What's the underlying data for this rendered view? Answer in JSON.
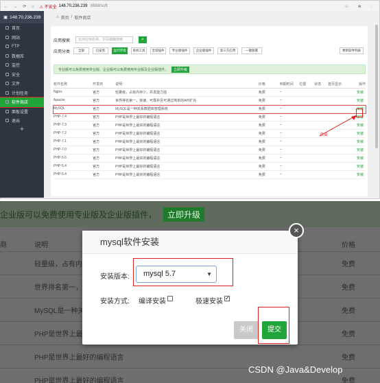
{
  "browser": {
    "nav": "← → ⟳ ⌂",
    "warn": "⚠ 不安全",
    "host": "148.70.236.239",
    "path": ":8888/soft",
    "icons": "☆ ⊕ :"
  },
  "sidebar": {
    "ip": "148.70.236.239",
    "items": [
      {
        "label": "首页"
      },
      {
        "label": "网站"
      },
      {
        "label": "FTP"
      },
      {
        "label": "数据库"
      },
      {
        "label": "监控"
      },
      {
        "label": "安全"
      },
      {
        "label": "文件"
      },
      {
        "label": "计划任务"
      },
      {
        "label": "软件商店"
      },
      {
        "label": "面板设置"
      },
      {
        "label": "退出"
      }
    ],
    "add": "+"
  },
  "crumb": {
    "home": "首页",
    "sep": "/",
    "current": "软件商店"
  },
  "search": {
    "label": "应用搜索",
    "placeholder": "支持应用名称、字段模糊搜索"
  },
  "categories": {
    "label": "应用分类",
    "items": [
      "全部",
      "已安装",
      "运行环境",
      "系统工具",
      "宝塔插件",
      "专业版插件",
      "企业版插件",
      "第三方应用",
      "一键部署"
    ],
    "filter": "更新软件列表"
  },
  "banner": {
    "text": "专业版可以免费使用专业版、企业版可以免费使用专业版及企业版插件，",
    "button": "立即升级"
  },
  "table": {
    "headers": [
      "软件名称",
      "开发商",
      "说明",
      "价格",
      "到期时间",
      "位置",
      "状态",
      "首页显示",
      "操作"
    ],
    "rows": [
      {
        "name": "Nginx",
        "dev": "官方",
        "desc": "轻量级，占有内存少，并发能力强",
        "price": "免费",
        "exp": "--",
        "op": "安装"
      },
      {
        "name": "Apache",
        "dev": "官方",
        "desc": "世界排名第一，快速、可靠并且可通过简单的API扩充",
        "price": "免费",
        "exp": "--",
        "op": "安装"
      },
      {
        "name": "MySQL",
        "dev": "官方",
        "desc": "MySQL是一种关系数据库管理系统",
        "price": "免费",
        "exp": "--",
        "op": "安装"
      },
      {
        "name": "PHP-7.4",
        "dev": "官方",
        "desc": "PHP是世界上最好的编程语言",
        "price": "免费",
        "exp": "--",
        "op": "安装"
      },
      {
        "name": "PHP-7.3",
        "dev": "官方",
        "desc": "PHP是世界上最好的编程语言",
        "price": "免费",
        "exp": "--",
        "op": "安装"
      },
      {
        "name": "PHP-7.2",
        "dev": "官方",
        "desc": "PHP是世界上最好的编程语言",
        "price": "免费",
        "exp": "--",
        "op": "安装"
      },
      {
        "name": "PHP-7.1",
        "dev": "官方",
        "desc": "PHP是世界上最好的编程语言",
        "price": "免费",
        "exp": "--",
        "op": "安装"
      },
      {
        "name": "PHP-7.0",
        "dev": "官方",
        "desc": "PHP是世界上最好的编程语言",
        "price": "免费",
        "exp": "--",
        "op": "安装"
      },
      {
        "name": "PHP-5.6",
        "dev": "官方",
        "desc": "PHP是世界上最好的编程语言",
        "price": "免费",
        "exp": "--",
        "op": "安装"
      },
      {
        "name": "PHP-5.4",
        "dev": "官方",
        "desc": "PHP是世界上最好的编程语言",
        "price": "免费",
        "exp": "--",
        "op": "安装"
      },
      {
        "name": "PHP-5.4",
        "dev": "官方",
        "desc": "PHP是世界上最好的编程语言",
        "price": "免费",
        "exp": "--",
        "op": "安装"
      }
    ]
  },
  "annotation": {
    "click": "点击"
  },
  "bottom": {
    "banner": "企业版可以免费使用专业版及企业版插件，",
    "upgrade": "立即升级",
    "head": {
      "c1": "商",
      "c2": "说明",
      "c3": "价格"
    },
    "rows": [
      {
        "c2": "轻量级，占有内存",
        "c3": "免费"
      },
      {
        "c2": "世界排名第一，快",
        "c3": "免费"
      },
      {
        "c2": "MySQL是一种关",
        "c3": "免费"
      },
      {
        "c2": "PHP是世界上最好",
        "c3": "免费"
      },
      {
        "c2": "PHP是世界上最好的编程语言",
        "c3": "免费"
      },
      {
        "c2": "PHP是世界上最好的编程语言",
        "c3": "免费"
      }
    ]
  },
  "dialog": {
    "title": "mysql软件安装",
    "version_label": "安装版本:",
    "version_value": "mysql 5.7",
    "method_label": "安装方式:",
    "compile": "编译安装",
    "fast": "极速安装",
    "close": "关闭",
    "submit": "提交",
    "x": "×"
  },
  "watermark": "CSDN @Java&Develop"
}
